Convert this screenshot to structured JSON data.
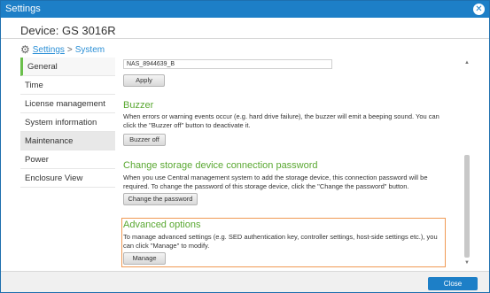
{
  "window": {
    "title": "Settings"
  },
  "device": {
    "label": "Device: GS 3016R"
  },
  "breadcrumb": {
    "root": "Settings",
    "separator": ">",
    "current": "System"
  },
  "sidebar": {
    "items": [
      {
        "label": "General",
        "state": "active"
      },
      {
        "label": "Time",
        "state": ""
      },
      {
        "label": "License management",
        "state": ""
      },
      {
        "label": "System information",
        "state": ""
      },
      {
        "label": "Maintenance",
        "state": "hover"
      },
      {
        "label": "Power",
        "state": ""
      },
      {
        "label": "Enclosure View",
        "state": ""
      }
    ]
  },
  "general": {
    "hostname_value": "NAS_8944639_B",
    "apply_label": "Apply"
  },
  "buzzer": {
    "title": "Buzzer",
    "description": "When errors or warning events occur (e.g. hard drive failure), the buzzer will emit a beeping sound. You can click the \"Buzzer off\" button to deactivate it.",
    "button_label": "Buzzer off"
  },
  "password": {
    "title": "Change storage device connection password",
    "description": "When you use Central management system to add the storage device, this connection password will be required. To change the password of this storage device, click the \"Change the password\" button.",
    "button_label": "Change the password"
  },
  "advanced": {
    "title": "Advanced options",
    "description": "To manage advanced settings (e.g. SED authentication key, controller settings, host-side settings etc.), you can click \"Manage\" to modify.",
    "button_label": "Manage"
  },
  "footer": {
    "close_label": "Close"
  },
  "colors": {
    "accent": "#1d7fc7",
    "section_title": "#5aa832",
    "highlight_border": "#f09a54",
    "active_marker": "#6abf4b"
  }
}
